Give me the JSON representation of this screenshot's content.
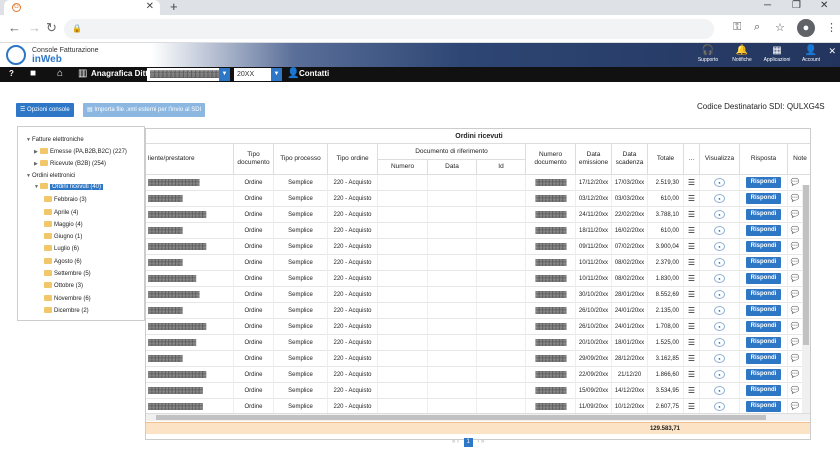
{
  "browser": {
    "tab_close": "✕",
    "new_tab": "+",
    "win_min": "─",
    "win_max": "❐",
    "win_close": "✕"
  },
  "app": {
    "title": "Console Fatturazione",
    "subtitle": "inWeb",
    "header_items": [
      {
        "label": "Supporto",
        "icon": "headset-icon",
        "glyph": "🎧"
      },
      {
        "label": "Notifiche",
        "icon": "bell-icon",
        "glyph": "🔔"
      },
      {
        "label": "Applicazioni",
        "icon": "grid-icon",
        "glyph": "▦"
      },
      {
        "label": "Account",
        "icon": "user-icon",
        "glyph": "👤"
      }
    ]
  },
  "toolbar": {
    "help": "?",
    "anagrafica_label": "Anagrafica Ditte",
    "company_value": "▓▓▓▓▓▓▓▓▓▓▓▓▓▓▓▓▓▓",
    "year_value": "20XX",
    "contatti_label": "Contatti"
  },
  "actions": {
    "opzioni_label": "Opzioni console",
    "importa_label": "Importa file .xml esterni per l'invio al SDI",
    "codice_destinatario": "Codice Destinatario SDI: QULXG4S"
  },
  "tree": {
    "fatture": "Fatture elettroniche",
    "emesse": "Emesse (PA,B2B,B2C) (227)",
    "ricevute": "Ricevute (B2B) (254)",
    "ordini": "Ordini elettronici",
    "ordini_ricevuti": "Ordini ricevuti (40)",
    "months": [
      "Febbraio (3)",
      "Aprile (4)",
      "Maggio (4)",
      "Giugno (1)",
      "Luglio (6)",
      "Agosto (6)",
      "Settembre (5)",
      "Ottobre (3)",
      "Novembre (6)",
      "Dicembre (2)"
    ]
  },
  "grid": {
    "title": "Ordini ricevuti",
    "headers": {
      "cliente": "liente/prestatore",
      "tipo_documento": "Tipo documento",
      "tipo_processo": "Tipo processo",
      "tipo_ordine": "Tipo ordine",
      "doc_riferimento": "Documento di riferimento",
      "numero": "Numero",
      "data": "Data",
      "id": "Id",
      "numero_documento": "Numero documento",
      "data_emissione": "Data emissione",
      "data_scadenza": "Data scadenza",
      "totale": "Totale",
      "more": "...",
      "visualizza": "Visualizza",
      "risposta": "Risposta",
      "note": "Note"
    },
    "rows": [
      {
        "cliente": "▓▓▓▓▓▓▓▓▓▓▓▓▓▓▓",
        "tipo_doc": "Ordine",
        "processo": "Semplice",
        "ordine": "220 - Acquisto",
        "numdoc": "▓▓▓▓▓▓▓▓▓",
        "emissione": "17/12/20xx",
        "scadenza": "17/03/20xx",
        "totale": "2.519,30"
      },
      {
        "cliente": "▓▓▓▓▓▓▓▓▓▓",
        "tipo_doc": "Ordine",
        "processo": "Semplice",
        "ordine": "220 - Acquisto",
        "numdoc": "▓▓▓▓▓▓▓▓▓",
        "emissione": "03/12/20xx",
        "scadenza": "03/03/20xx",
        "totale": "610,00"
      },
      {
        "cliente": "▓▓▓▓▓▓▓▓▓▓▓▓▓▓▓▓▓",
        "tipo_doc": "Ordine",
        "processo": "Semplice",
        "ordine": "220 - Acquisto",
        "numdoc": "▓▓▓▓▓▓▓▓▓",
        "emissione": "24/11/20xx",
        "scadenza": "22/02/20xx",
        "totale": "3.788,10"
      },
      {
        "cliente": "▓▓▓▓▓▓▓▓▓▓",
        "tipo_doc": "Ordine",
        "processo": "Semplice",
        "ordine": "220 - Acquisto",
        "numdoc": "▓▓▓▓▓▓▓▓▓",
        "emissione": "18/11/20xx",
        "scadenza": "16/02/20xx",
        "totale": "610,00"
      },
      {
        "cliente": "▓▓▓▓▓▓▓▓▓▓▓▓▓▓▓▓▓",
        "tipo_doc": "Ordine",
        "processo": "Semplice",
        "ordine": "220 - Acquisto",
        "numdoc": "▓▓▓▓▓▓▓▓▓",
        "emissione": "09/11/20xx",
        "scadenza": "07/02/20xx",
        "totale": "3.900,04"
      },
      {
        "cliente": "▓▓▓▓▓▓▓▓▓▓",
        "tipo_doc": "Ordine",
        "processo": "Semplice",
        "ordine": "220 - Acquisto",
        "numdoc": "▓▓▓▓▓▓▓▓▓",
        "emissione": "10/11/20xx",
        "scadenza": "08/02/20xx",
        "totale": "2.379,00"
      },
      {
        "cliente": "▓▓▓▓▓▓▓▓▓▓▓▓▓▓",
        "tipo_doc": "Ordine",
        "processo": "Semplice",
        "ordine": "220 - Acquisto",
        "numdoc": "▓▓▓▓▓▓▓▓▓",
        "emissione": "10/11/20xx",
        "scadenza": "08/02/20xx",
        "totale": "1.830,00"
      },
      {
        "cliente": "▓▓▓▓▓▓▓▓▓▓▓▓▓▓▓",
        "tipo_doc": "Ordine",
        "processo": "Semplice",
        "ordine": "220 - Acquisto",
        "numdoc": "▓▓▓▓▓▓▓▓▓",
        "emissione": "30/10/20xx",
        "scadenza": "28/01/20xx",
        "totale": "8.552,69"
      },
      {
        "cliente": "▓▓▓▓▓▓▓▓▓▓",
        "tipo_doc": "Ordine",
        "processo": "Semplice",
        "ordine": "220 - Acquisto",
        "numdoc": "▓▓▓▓▓▓▓▓▓",
        "emissione": "26/10/20xx",
        "scadenza": "24/01/20xx",
        "totale": "2.135,00"
      },
      {
        "cliente": "▓▓▓▓▓▓▓▓▓▓▓▓▓▓▓▓▓",
        "tipo_doc": "Ordine",
        "processo": "Semplice",
        "ordine": "220 - Acquisto",
        "numdoc": "▓▓▓▓▓▓▓▓▓",
        "emissione": "26/10/20xx",
        "scadenza": "24/01/20xx",
        "totale": "1.708,00"
      },
      {
        "cliente": "▓▓▓▓▓▓▓▓▓▓▓▓▓▓",
        "tipo_doc": "Ordine",
        "processo": "Semplice",
        "ordine": "220 - Acquisto",
        "numdoc": "▓▓▓▓▓▓▓▓▓",
        "emissione": "20/10/20xx",
        "scadenza": "18/01/20xx",
        "totale": "1.525,00"
      },
      {
        "cliente": "▓▓▓▓▓▓▓▓▓▓",
        "tipo_doc": "Ordine",
        "processo": "Semplice",
        "ordine": "220 - Acquisto",
        "numdoc": "▓▓▓▓▓▓▓▓▓",
        "emissione": "29/09/20xx",
        "scadenza": "28/12/20xx",
        "totale": "3.162,85"
      },
      {
        "cliente": "▓▓▓▓▓▓▓▓▓▓▓▓▓▓▓▓▓",
        "tipo_doc": "Ordine",
        "processo": "Semplice",
        "ordine": "220 - Acquisto",
        "numdoc": "▓▓▓▓▓▓▓▓▓",
        "emissione": "22/09/20xx",
        "scadenza": "21/12/20",
        "totale": "1.866,60"
      },
      {
        "cliente": "▓▓▓▓▓▓▓▓▓▓▓▓▓▓▓▓",
        "tipo_doc": "Ordine",
        "processo": "Semplice",
        "ordine": "220 - Acquisto",
        "numdoc": "▓▓▓▓▓▓▓▓▓",
        "emissione": "15/09/20xx",
        "scadenza": "14/12/20xx",
        "totale": "3.534,95"
      },
      {
        "cliente": "▓▓▓▓▓▓▓▓▓▓▓▓▓▓▓▓",
        "tipo_doc": "Ordine",
        "processo": "Semplice",
        "ordine": "220 - Acquisto",
        "numdoc": "▓▓▓▓▓▓▓▓▓",
        "emissione": "11/09/20xx",
        "scadenza": "10/12/20xx",
        "totale": "2.607,75"
      }
    ],
    "risposta_label": "Rispondi",
    "visualizza_icon": "pdf-icon",
    "total": "129.583,71"
  },
  "pager": {
    "first": "«",
    "prev": "‹",
    "current": "1",
    "next": "›",
    "last": "»"
  }
}
